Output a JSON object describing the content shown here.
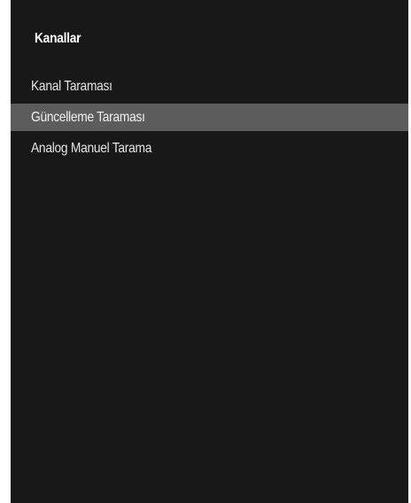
{
  "panel": {
    "title": "Kanallar",
    "items": [
      {
        "label": "Kanal Taraması",
        "selected": false
      },
      {
        "label": "Güncelleme Taraması",
        "selected": true
      },
      {
        "label": "Analog Manuel Tarama",
        "selected": false
      }
    ]
  },
  "colors": {
    "panel_background": "#181818",
    "selected_background": "#5c5c5c",
    "text": "#e6e6e6"
  }
}
